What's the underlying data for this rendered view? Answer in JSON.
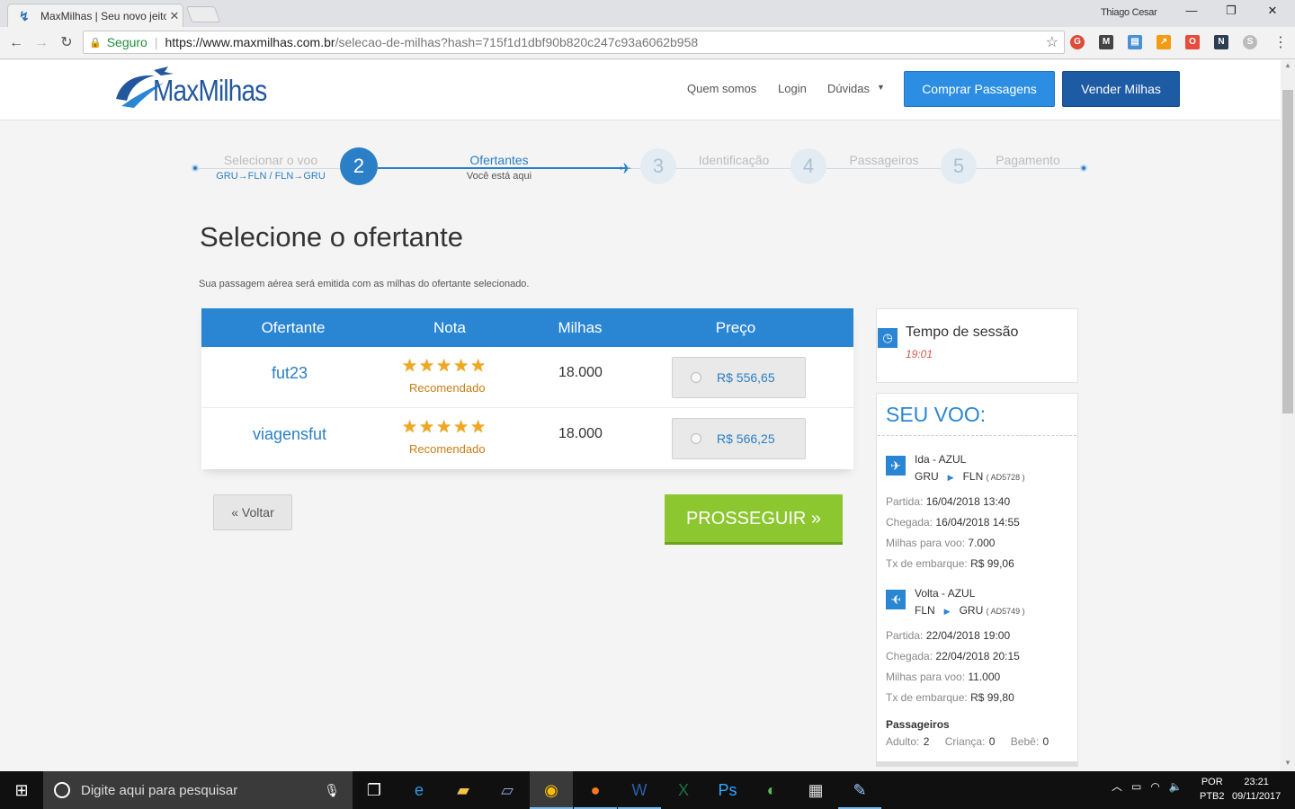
{
  "browser": {
    "tab_title": "MaxMilhas | Seu novo jeito",
    "user": "Thiago Cesar",
    "secure_label": "Seguro",
    "url_host": "https://www.maxmilhas.com.br",
    "url_path": "/selecao-de-milhas?hash=715f1d1dbf90b820c247c93a6062b958",
    "win_min": "—",
    "win_max": "❐",
    "win_close": "✕"
  },
  "site": {
    "logo_text": "MaxMilhas",
    "nav": [
      "Quem somos",
      "Login",
      "Dúvidas"
    ],
    "btn_comprar": "Comprar Passagens",
    "btn_vender": "Vender Milhas"
  },
  "steps": {
    "s1_label": "Selecionar o voo",
    "s1_sub": "GRU→FLN / FLN→GRU",
    "s2_num": "2",
    "s2_label": "Ofertantes",
    "s2_sub": "Você está aqui",
    "s3_num": "3",
    "s3_label": "Identificação",
    "s4_num": "4",
    "s4_label": "Passageiros",
    "s5_num": "5",
    "s5_label": "Pagamento"
  },
  "main": {
    "title": "Selecione o ofertante",
    "description": "Sua passagem aérea será emitida com as milhas do ofertante selecionado.",
    "headers": [
      "Ofertante",
      "Nota",
      "Milhas",
      "Preço"
    ],
    "rows": [
      {
        "name": "fut23",
        "stars": "★★★★★",
        "rating_label": "Recomendado",
        "miles": "18.000",
        "price": "R$ 556,65"
      },
      {
        "name": "viagensfut",
        "stars": "★★★★★",
        "rating_label": "Recomendado",
        "miles": "18.000",
        "price": "R$ 566,25"
      }
    ],
    "btn_voltar": "« Voltar",
    "btn_prosseguir": "PROSSEGUIR »"
  },
  "sidebar": {
    "session_label": "Tempo de sessão",
    "session_time": "19:01",
    "flight_title": "SEU VOO:",
    "ida": {
      "label": "Ida - AZUL",
      "from": "GRU",
      "to": "FLN",
      "code": "( AD5728 )",
      "partida_label": "Partida:",
      "partida": "16/04/2018 13:40",
      "chegada_label": "Chegada:",
      "chegada": "16/04/2018 14:55",
      "milhas_label": "Milhas para voo:",
      "milhas": "7.000",
      "tx_label": "Tx de embarque:",
      "tx": "R$ 99,06"
    },
    "volta": {
      "label": "Volta - AZUL",
      "from": "FLN",
      "to": "GRU",
      "code": "( AD5749 )",
      "partida_label": "Partida:",
      "partida": "22/04/2018 19:00",
      "chegada_label": "Chegada:",
      "chegada": "22/04/2018 20:15",
      "milhas_label": "Milhas para voo:",
      "milhas": "11.000",
      "tx_label": "Tx de embarque:",
      "tx": "R$ 99,80"
    },
    "pax_title": "Passageiros",
    "adulto_label": "Adulto:",
    "adulto": "2",
    "crianca_label": "Criança:",
    "crianca": "0",
    "bebe_label": "Bebê:",
    "bebe": "0"
  },
  "taskbar": {
    "search_placeholder": "Digite aqui para pesquisar",
    "lang1": "POR",
    "lang2": "PTB2",
    "time": "23:21",
    "date": "09/11/2017"
  },
  "colors": {
    "brand_blue": "#2a86d3",
    "dark_blue": "#1e5ba5",
    "green": "#8cc730",
    "star": "#f0a81d"
  }
}
